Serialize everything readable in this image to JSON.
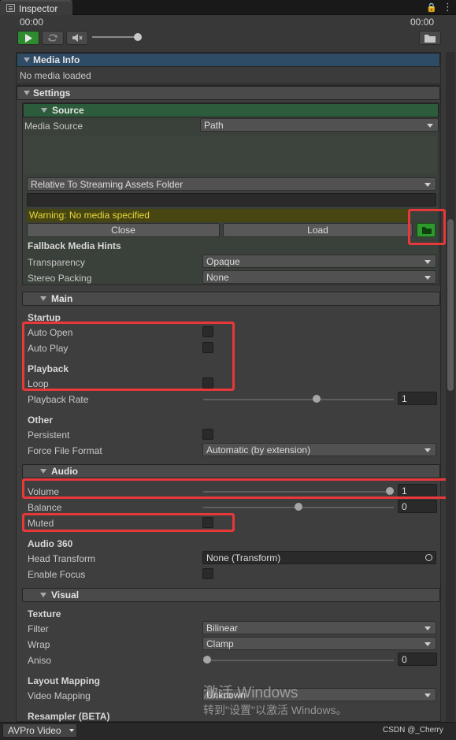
{
  "tab": {
    "title": "Inspector"
  },
  "timecodes": {
    "left": "00:00",
    "right": "00:00"
  },
  "controls": {
    "play_icon": "play-icon",
    "loop_icon": "loop-icon",
    "mute_icon": "mute-icon",
    "folder_icon": "folder-icon",
    "volume_level": 1.0
  },
  "media_info": {
    "title": "Media Info",
    "status": "No media loaded"
  },
  "settings": {
    "title": "Settings"
  },
  "source": {
    "title": "Source",
    "media_source_label": "Media Source",
    "media_source_value": "Path",
    "location_value": "Relative To Streaming Assets Folder",
    "path_value": "",
    "warning": "Warning: No media specified",
    "close_label": "Close",
    "load_label": "Load",
    "fallback_title": "Fallback Media Hints",
    "transparency_label": "Transparency",
    "transparency_value": "Opaque",
    "stereo_label": "Stereo Packing",
    "stereo_value": "None"
  },
  "main": {
    "title": "Main",
    "startup": "Startup",
    "auto_open": "Auto Open",
    "auto_play": "Auto Play",
    "playback": "Playback",
    "loop": "Loop",
    "playback_rate_label": "Playback Rate",
    "playback_rate_value": "1",
    "playback_rate_level": 0.6,
    "other": "Other",
    "persistent": "Persistent",
    "force_format_label": "Force File Format",
    "force_format_value": "Automatic (by extension)"
  },
  "audio": {
    "title": "Audio",
    "volume_label": "Volume",
    "volume_value": "1",
    "volume_level": 1.0,
    "balance_label": "Balance",
    "balance_value": "0",
    "balance_level": 0.5,
    "muted_label": "Muted",
    "audio360": "Audio 360",
    "head_transform_label": "Head Transform",
    "head_transform_value": "None (Transform)",
    "enable_focus": "Enable Focus"
  },
  "visual": {
    "title": "Visual",
    "texture": "Texture",
    "filter_label": "Filter",
    "filter_value": "Bilinear",
    "wrap_label": "Wrap",
    "wrap_value": "Clamp",
    "aniso_label": "Aniso",
    "aniso_value": "0",
    "aniso_level": 0.0,
    "layout_mapping": "Layout Mapping",
    "video_mapping_label": "Video Mapping",
    "video_mapping_value": "Unknown",
    "resampler": "Resampler (BETA)"
  },
  "watermark": {
    "line1": "激活 Windows",
    "line2": "转到\"设置\"以激活 Windows。"
  },
  "bottom": {
    "component": "AVPro Video",
    "credit": "CSDN @_Cherry"
  }
}
